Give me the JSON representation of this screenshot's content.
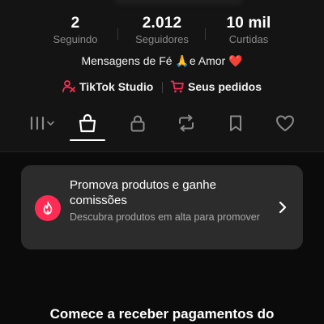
{
  "profile": {
    "stats": [
      {
        "value": "2",
        "label": "Seguindo"
      },
      {
        "value": "2.012",
        "label": "Seguidores"
      },
      {
        "value": "10 mil",
        "label": "Curtidas"
      }
    ],
    "bio": "Mensagens de Fé 🙏e Amor ❤️",
    "links": {
      "studio": "TikTok Studio",
      "orders": "Seus pedidos"
    }
  },
  "tabs": {
    "items": [
      "videos-grid",
      "shop",
      "private",
      "reposts",
      "favorites",
      "liked"
    ],
    "active": "shop"
  },
  "promo": {
    "title": "Promova produtos e ganhe comissões",
    "subtitle": "Descubra produtos em alta para promover"
  },
  "bottom": {
    "text": "Comece a receber pagamentos do"
  },
  "colors": {
    "accent": "#fe2c55",
    "background": "#0b0b0b",
    "card": "#2c2c2c"
  }
}
